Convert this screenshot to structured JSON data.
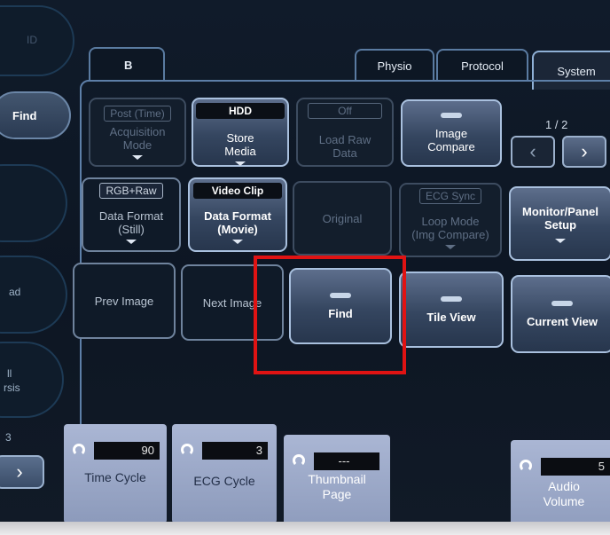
{
  "rail": {
    "top_label": "ID",
    "find_label": "Find",
    "partial_1": "ad",
    "partial_2": "ll",
    "partial_3": "rsis",
    "partial_4": "3",
    "next_icon": "chevron-right-icon"
  },
  "tabs": [
    {
      "label": "B"
    },
    {
      "label": "Physio"
    },
    {
      "label": "Protocol"
    },
    {
      "label": "System",
      "active": true
    }
  ],
  "page_indicator": "1 / 2",
  "buttons": {
    "acquisition": {
      "chip": "Post (Time)",
      "label1": "Acquisition",
      "label2": "Mode"
    },
    "store_media": {
      "chip": "HDD",
      "label1": "Store",
      "label2": "Media"
    },
    "load_raw": {
      "chip": "Off",
      "label1": "Load Raw",
      "label2": "Data"
    },
    "image_compare": {
      "label1": "Image",
      "label2": "Compare"
    },
    "data_format_still": {
      "chip": "RGB+Raw",
      "label1": "Data Format",
      "label2": "(Still)"
    },
    "data_format_movie": {
      "chip": "Video Clip",
      "label1": "Data Format",
      "label2": "(Movie)"
    },
    "original": {
      "label": "Original"
    },
    "loop_mode": {
      "chip": "ECG Sync",
      "label1": "Loop Mode",
      "label2": "(Img Compare)"
    },
    "monitor_panel": {
      "label1": "Monitor/Panel",
      "label2": "Setup"
    },
    "prev_image": {
      "label": "Prev Image"
    },
    "next_image": {
      "label": "Next Image"
    },
    "find": {
      "label": "Find"
    },
    "tile_view": {
      "label": "Tile View"
    },
    "current_view": {
      "label": "Current View"
    }
  },
  "knobs": {
    "time_cycle": {
      "value": "90",
      "label": "Time Cycle"
    },
    "ecg_cycle": {
      "value": "3",
      "label": "ECG Cycle"
    },
    "thumbnail_page": {
      "value": "---",
      "label1": "Thumbnail",
      "label2": "Page"
    },
    "audio_volume": {
      "value": "5",
      "label1": "Audio",
      "label2": "Volume"
    }
  },
  "colors": {
    "highlight": "#e01313",
    "accent": "#8fb0d6",
    "knob": "#9aa7c8"
  }
}
